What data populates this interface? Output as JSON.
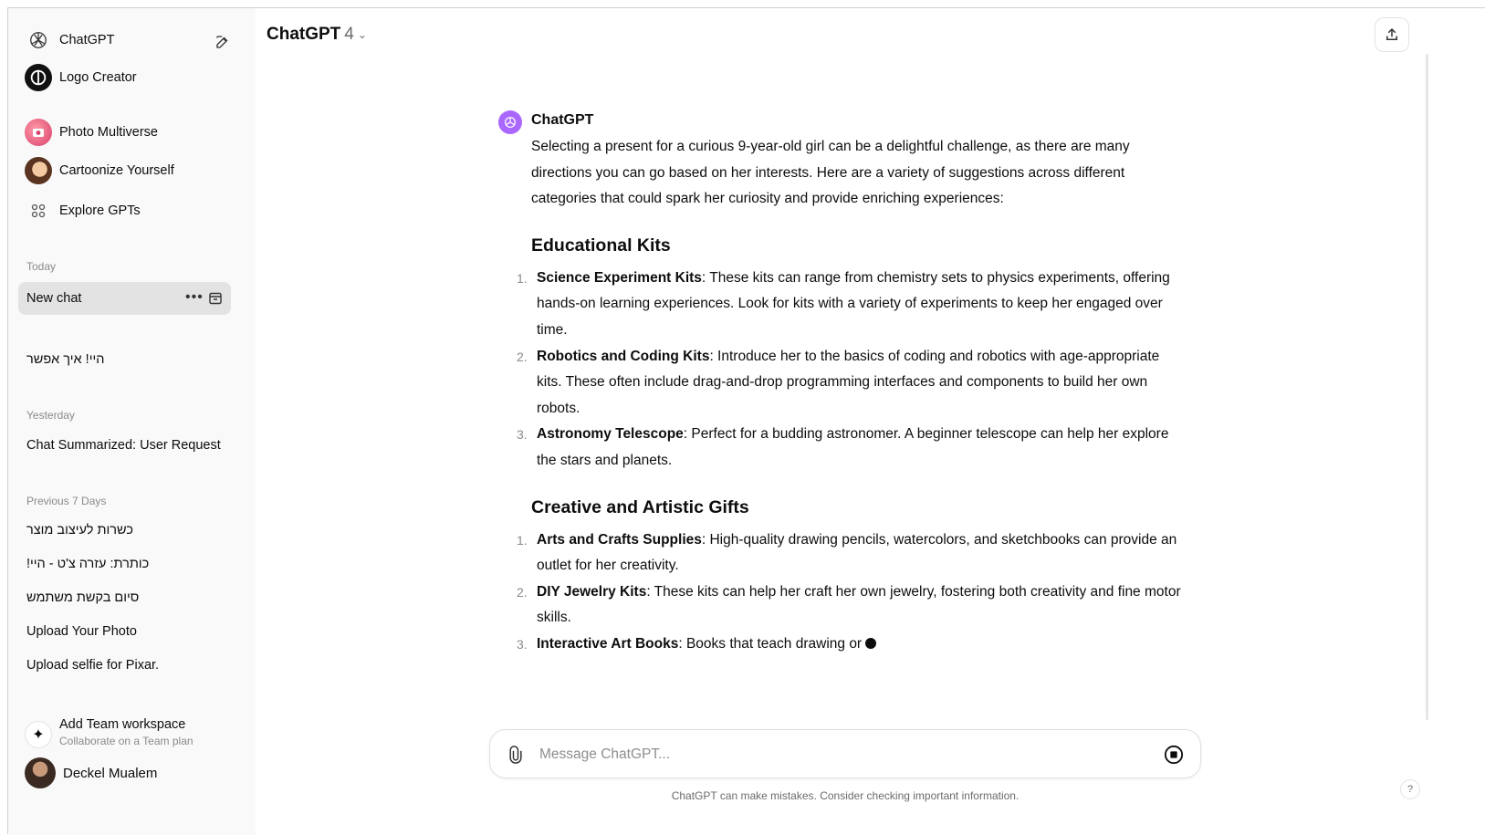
{
  "sidebar": {
    "top_items": [
      {
        "label": "ChatGPT",
        "icon": "openai-logo-icon"
      },
      {
        "label": "Logo Creator",
        "icon": "logo-creator-avatar"
      },
      {
        "label": "Photo Multiverse",
        "icon": "photo-multiverse-avatar"
      },
      {
        "label": "Cartoonize Yourself",
        "icon": "cartoonize-avatar"
      },
      {
        "label": "Explore GPTs",
        "icon": "grid-icon"
      }
    ],
    "groups": {
      "today": {
        "heading": "Today",
        "active_chat": "New chat",
        "items": [
          "היי! איך אפשר"
        ]
      },
      "yesterday": {
        "heading": "Yesterday",
        "items": [
          "Chat Summarized: User Request"
        ]
      },
      "previous7": {
        "heading": "Previous 7 Days",
        "items": [
          "כשרות לעיצוב מוצר",
          "כותרת: עזרה צ'ט - היי!",
          "סיום בקשת משתמש",
          "Upload Your Photo",
          "Upload selfie for Pixar."
        ]
      }
    },
    "team": {
      "title": "Add Team workspace",
      "subtitle": "Collaborate on a Team plan"
    },
    "user": {
      "name": "Deckel Mualem"
    }
  },
  "header": {
    "model": "ChatGPT",
    "version": "4"
  },
  "message": {
    "author": "ChatGPT",
    "intro": "Selecting a present for a curious 9-year-old girl can be a delightful challenge, as there are many directions you can go based on her interests. Here are a variety of suggestions across different categories that could spark her curiosity and provide enriching experiences:",
    "sections": [
      {
        "heading": "Educational Kits",
        "items": [
          {
            "num": "1.",
            "title": "Science Experiment Kits",
            "text": ": These kits can range from chemistry sets to physics experiments, offering hands-on learning experiences. Look for kits with a variety of experiments to keep her engaged over time."
          },
          {
            "num": "2.",
            "title": "Robotics and Coding Kits",
            "text": ": Introduce her to the basics of coding and robotics with age-appropriate kits. These often include drag-and-drop programming interfaces and components to build her own robots."
          },
          {
            "num": "3.",
            "title": "Astronomy Telescope",
            "text": ": Perfect for a budding astronomer. A beginner telescope can help her explore the stars and planets."
          }
        ]
      },
      {
        "heading": "Creative and Artistic Gifts",
        "items": [
          {
            "num": "1.",
            "title": "Arts and Crafts Supplies",
            "text": ": High-quality drawing pencils, watercolors, and sketchbooks can provide an outlet for her creativity."
          },
          {
            "num": "2.",
            "title": "DIY Jewelry Kits",
            "text": ": These kits can help her craft her own jewelry, fostering both creativity and fine motor skills."
          },
          {
            "num": "3.",
            "title": "Interactive Art Books",
            "text": ": Books that teach drawing or"
          }
        ]
      }
    ]
  },
  "composer": {
    "placeholder": "Message ChatGPT..."
  },
  "footer": {
    "note": "ChatGPT can make mistakes. Consider checking important information.",
    "help": "?"
  },
  "colors": {
    "sidebar_bg": "#f9f9f9",
    "active_chat_bg": "#e3e3e3",
    "assistant_avatar": "#ab68ff"
  }
}
